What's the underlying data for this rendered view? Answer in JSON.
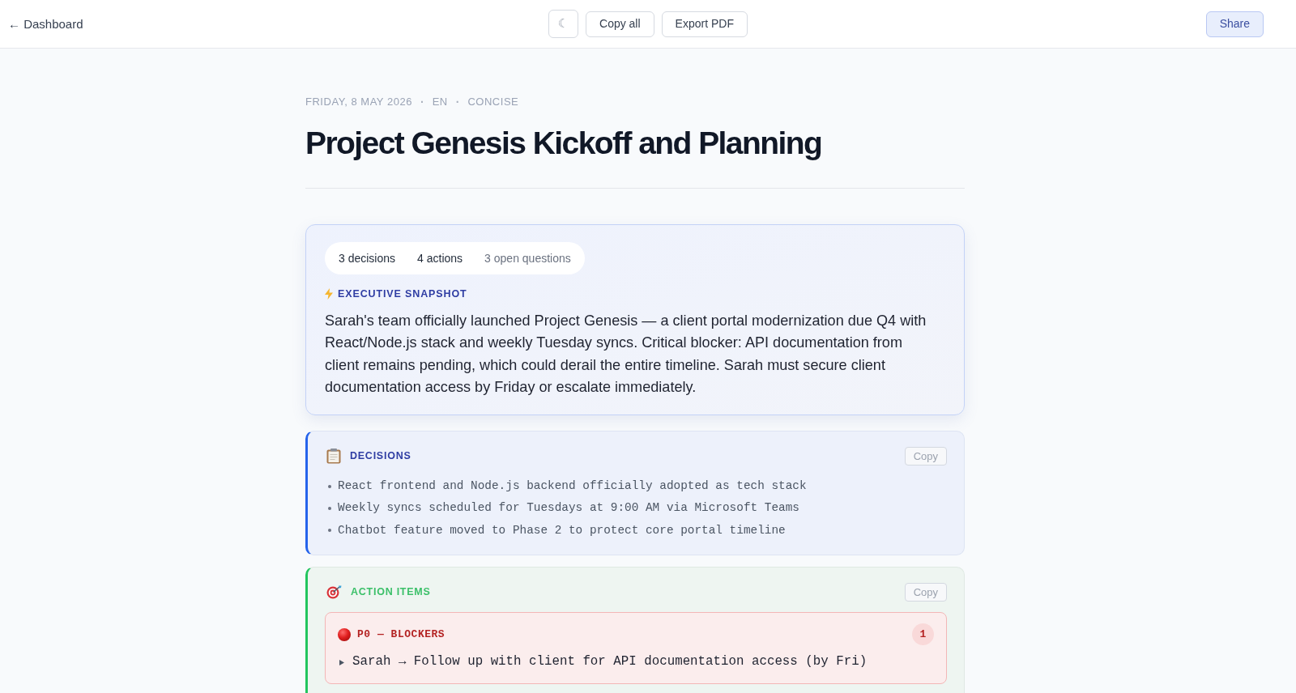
{
  "header": {
    "back_link": "← Dashboard",
    "theme_toggle": "☾",
    "actions": [
      "Copy all",
      "Export PDF"
    ],
    "share": "Share"
  },
  "meta": [
    {
      "kind": "text",
      "text": "FRIDAY, 8 MAY 2026"
    },
    {
      "kind": "separator",
      "text": "·"
    },
    {
      "kind": "text",
      "text": "EN"
    },
    {
      "kind": "separator",
      "text": "·"
    },
    {
      "kind": "text",
      "text": "CONCISE"
    }
  ],
  "title": "Project Genesis Kickoff and Planning",
  "snapshot": {
    "stats": [
      {
        "text": "3 decisions",
        "muted": false
      },
      {
        "text": "4 actions",
        "muted": false
      },
      {
        "text": "3 open questions",
        "muted": true
      }
    ],
    "label": "EXECUTIVE SNAPSHOT",
    "summary": "Sarah's team officially launched Project Genesis — a client portal modernization due Q4 with React/Node.js stack and weekly Tuesday syncs. Critical blocker: API documentation from client remains pending, which could derail the entire timeline. Sarah must secure client documentation access by Friday or escalate immediately."
  },
  "sections": [
    {
      "kind": "decisions",
      "title": "DECISIONS",
      "copy_button": "Copy",
      "items": [
        "React frontend and Node.js backend officially adopted as tech stack",
        "Weekly syncs scheduled for Tuesdays at 9:00 AM via Microsoft Teams",
        "Chatbot feature moved to Phase 2 to protect core portal timeline"
      ]
    },
    {
      "kind": "actions",
      "title": "ACTION ITEMS",
      "copy_button": "Copy",
      "groups": [
        {
          "kind": "blocker",
          "title": "P0 — BLOCKERS",
          "count": "1",
          "items": [
            "Sarah → Follow up with client for API documentation access (by Fri)"
          ]
        }
      ]
    }
  ]
}
